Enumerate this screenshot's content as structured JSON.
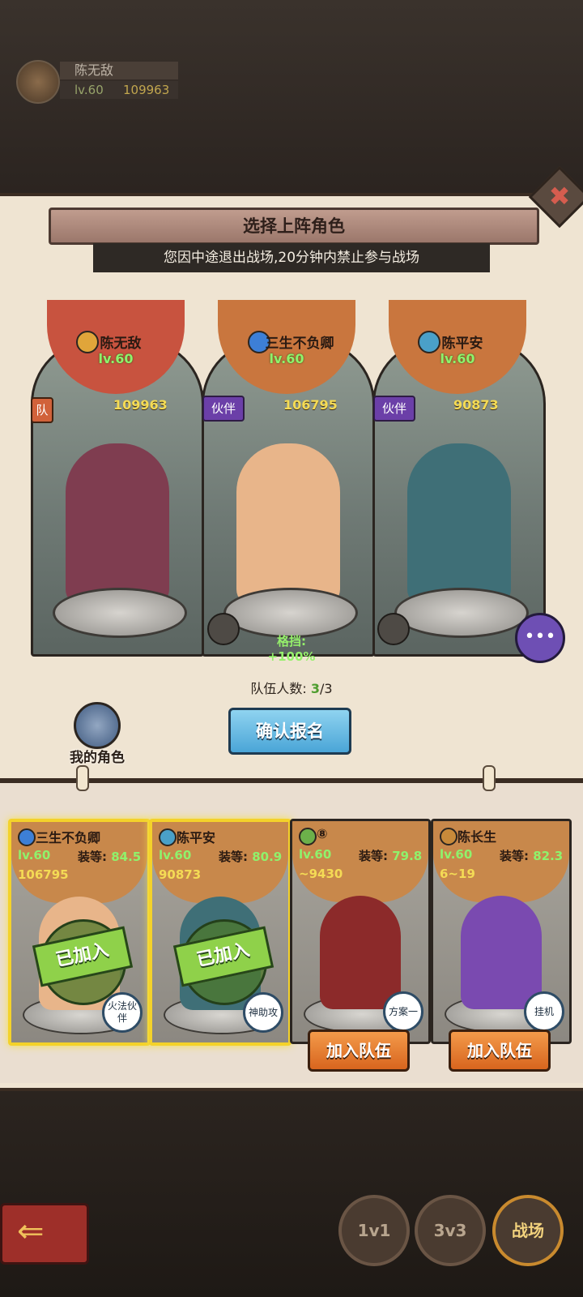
{
  "player": {
    "name": "陈无敌",
    "level": "lv.60",
    "power": "109963"
  },
  "dialog": {
    "title": "选择上阵角色",
    "notice": "您因中途退出战场,20分钟内禁止参与战场",
    "close_label": "✖"
  },
  "team": [
    {
      "name": "陈无敌",
      "level": "lv.60",
      "power": "109963",
      "tag": "队",
      "banner_color": "#c8533f",
      "element_color": "#e0a53a",
      "figure_color": "#7f3d50"
    },
    {
      "name": "三生不负卿",
      "level": "lv.60",
      "power": "106795",
      "tag": "伙伴",
      "banner_color": "#c9763e",
      "element_color": "#3d7fd6",
      "figure_color": "#e8b58a",
      "bonus": "格挡: +100%"
    },
    {
      "name": "陈平安",
      "level": "lv.60",
      "power": "90873",
      "tag": "伙伴",
      "banner_color": "#c9763e",
      "element_color": "#4aa0c8",
      "figure_color": "#3f6f77"
    }
  ],
  "team_count": {
    "label": "队伍人数:",
    "current": "3",
    "total": "/3"
  },
  "confirm_label": "确认报名",
  "my_role_label": "我的角色",
  "roster": [
    {
      "name": "三生不负卿",
      "level": "lv.60",
      "equip_label": "装等:",
      "equip": "84.5",
      "power": "106795",
      "badge": "火法伙伴",
      "status": "已加入",
      "figure_color": "#e8b58a",
      "element_color": "#3d7fd6"
    },
    {
      "name": "陈平安",
      "level": "lv.60",
      "equip_label": "装等:",
      "equip": "80.9",
      "power": "90873",
      "badge": "神助攻",
      "status": "已加入",
      "figure_color": "#3f6f77",
      "element_color": "#4aa0c8"
    },
    {
      "name": "⑧",
      "level": "lv.60",
      "equip_label": "装等:",
      "equip": "79.8",
      "power": "~9430",
      "badge": "方案一",
      "figure_color": "#8c2a2a",
      "element_color": "#6cb04a",
      "action": "加入队伍"
    },
    {
      "name": "陈长生",
      "level": "lv.60",
      "equip_label": "装等:",
      "equip": "82.3",
      "power": "6~19",
      "badge": "挂机",
      "figure_color": "#7a4ab0",
      "element_color": "#c88a3a",
      "action": "加入队伍"
    }
  ],
  "modes": [
    "1v1",
    "3v3",
    "战场"
  ],
  "colors": {
    "accent": "#4aa5d7",
    "join": "#d8651e",
    "selected": "#f4d22a"
  }
}
